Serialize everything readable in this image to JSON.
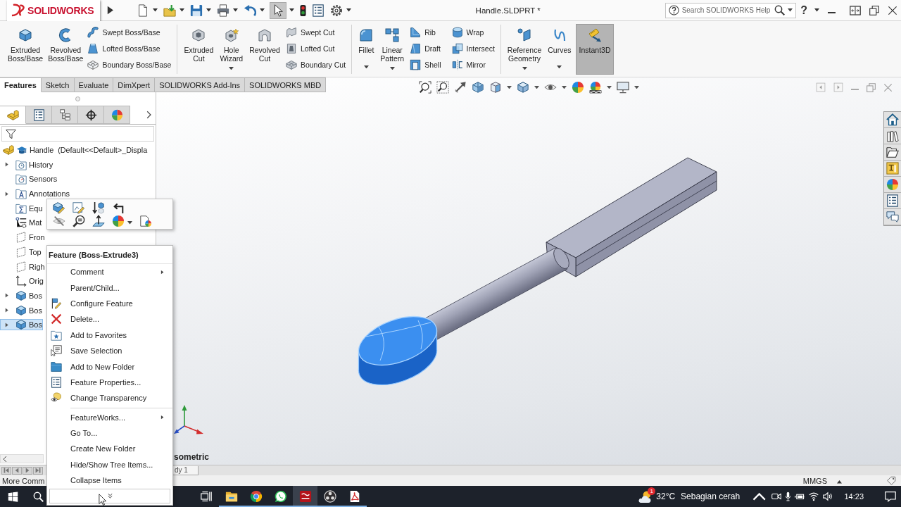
{
  "title_bar": {
    "logo": "SOLIDWORKS",
    "title": "Handle.SLDPRT *",
    "search": {
      "placeholder": "Search SOLIDWORKS Help"
    },
    "help": "?"
  },
  "quick_access": [
    {
      "dropdown": true,
      "on": false
    },
    {
      "dropdown": true,
      "on": false
    },
    {
      "dropdown": true,
      "on": false
    },
    {
      "dropdown": true,
      "on": false
    },
    {
      "dropdown": true,
      "on": false
    },
    {
      "dropdown": true,
      "on": true
    },
    {
      "dropdown": false,
      "on": false
    },
    {
      "dropdown": false,
      "on": false
    },
    {
      "dropdown": true,
      "on": false
    }
  ],
  "ribbon": {
    "groups": [
      {
        "items": [
          {
            "kind": "large",
            "label": "Extruded Boss/Base",
            "dropdown": false,
            "on": false
          },
          {
            "kind": "large",
            "label": "Revolved Boss/Base",
            "dropdown": false,
            "on": false
          },
          {
            "kind": "stack",
            "entries": [
              "Swept Boss/Base",
              "Lofted Boss/Base",
              "Boundary Boss/Base"
            ]
          }
        ]
      },
      {
        "items": [
          {
            "kind": "large",
            "label": "Extruded Cut",
            "dropdown": false,
            "on": false
          },
          {
            "kind": "large",
            "label": "Hole Wizard",
            "dropdown": true,
            "on": false
          },
          {
            "kind": "large",
            "label": "Revolved Cut",
            "dropdown": false,
            "on": false
          },
          {
            "kind": "stack",
            "entries": [
              "Swept Cut",
              "Lofted Cut",
              "Boundary Cut"
            ]
          }
        ]
      },
      {
        "items": [
          {
            "kind": "large",
            "label": "Fillet",
            "dropdown": true,
            "on": false
          },
          {
            "kind": "large",
            "label": "Linear Pattern",
            "dropdown": true,
            "on": false
          },
          {
            "kind": "stack",
            "entries": [
              "Rib",
              "Draft",
              "Shell"
            ]
          },
          {
            "kind": "stack",
            "entries": [
              "Wrap",
              "Intersect",
              "Mirror"
            ]
          }
        ]
      },
      {
        "items": [
          {
            "kind": "large",
            "label": "Reference Geometry",
            "dropdown": true,
            "on": false
          },
          {
            "kind": "large",
            "label": "Curves",
            "dropdown": true,
            "on": false
          },
          {
            "kind": "large",
            "label": "Instant3D",
            "dropdown": false,
            "on": true
          }
        ]
      }
    ]
  },
  "command_tabs": [
    {
      "label": "Features",
      "selected": true
    },
    {
      "label": "Sketch",
      "selected": false
    },
    {
      "label": "Evaluate",
      "selected": false
    },
    {
      "label": "DimXpert",
      "selected": false
    },
    {
      "label": "SOLIDWORKS Add-Ins",
      "selected": false
    },
    {
      "label": "SOLIDWORKS MBD",
      "selected": false
    }
  ],
  "feature_manager": {
    "tabs": [
      {
        "selected": true
      },
      {
        "selected": false
      },
      {
        "selected": false
      },
      {
        "selected": false
      },
      {
        "selected": false
      }
    ],
    "tree": {
      "label": "Handle  (Default<<Default>_Displa",
      "expandable": false,
      "selected": false,
      "children": [
        {
          "label": "History",
          "expandable": true,
          "expanded": false,
          "selected": false
        },
        {
          "label": "Sensors",
          "expandable": false,
          "selected": false
        },
        {
          "label": "Annotations",
          "expandable": true,
          "expanded": false,
          "selected": false
        },
        {
          "label": "Equ",
          "expandable": false,
          "selected": false
        },
        {
          "label": "Mat",
          "expandable": false,
          "selected": false
        },
        {
          "label": "Fron",
          "expandable": false,
          "selected": false
        },
        {
          "label": "Top",
          "expandable": false,
          "selected": false
        },
        {
          "label": "Righ",
          "expandable": false,
          "selected": false
        },
        {
          "label": "Orig",
          "expandable": false,
          "selected": false
        },
        {
          "label": "Bos",
          "expandable": true,
          "expanded": false,
          "selected": false
        },
        {
          "label": "Bos",
          "expandable": true,
          "expanded": false,
          "selected": false
        },
        {
          "label": "Bos",
          "expandable": true,
          "expanded": false,
          "selected": true
        }
      ]
    }
  },
  "context_menu": {
    "title": "Feature (Boss-Extrude3)",
    "sections": [
      [
        {
          "label": "Comment",
          "submenu": true
        },
        {
          "label": "Parent/Child...",
          "submenu": false
        },
        {
          "label": "Configure Feature",
          "submenu": false
        },
        {
          "label": "Delete...",
          "submenu": false
        },
        {
          "label": "Add to Favorites",
          "submenu": false
        },
        {
          "label": "Save Selection",
          "submenu": false
        },
        {
          "label": "Add to New Folder",
          "submenu": false
        },
        {
          "label": "Feature Properties...",
          "submenu": false
        },
        {
          "label": "Change Transparency",
          "submenu": false
        }
      ],
      [
        {
          "label": "FeatureWorks...",
          "submenu": true
        },
        {
          "label": "Go To...",
          "submenu": false
        },
        {
          "label": "Create New Folder",
          "submenu": false
        },
        {
          "label": "Hide/Show Tree Items...",
          "submenu": false
        },
        {
          "label": "Collapse Items",
          "submenu": false
        }
      ]
    ]
  },
  "viewport": {
    "view_name": "sometric"
  },
  "bottom_tabs": [
    {
      "label": "dy 1"
    }
  ],
  "status_bar": {
    "message": "More Comm",
    "units": "MMGS"
  },
  "taskbar": {
    "apps": [
      {
        "running": true,
        "active": false
      },
      {
        "running": true,
        "active": false
      },
      {
        "running": true,
        "active": false
      },
      {
        "running": true,
        "active": true
      },
      {
        "running": true,
        "active": false
      },
      {
        "running": true,
        "active": false
      }
    ],
    "weather": {
      "badge": "1",
      "temperature": "32°C",
      "condition": "Sebagian cerah"
    },
    "clock": "14:23"
  }
}
